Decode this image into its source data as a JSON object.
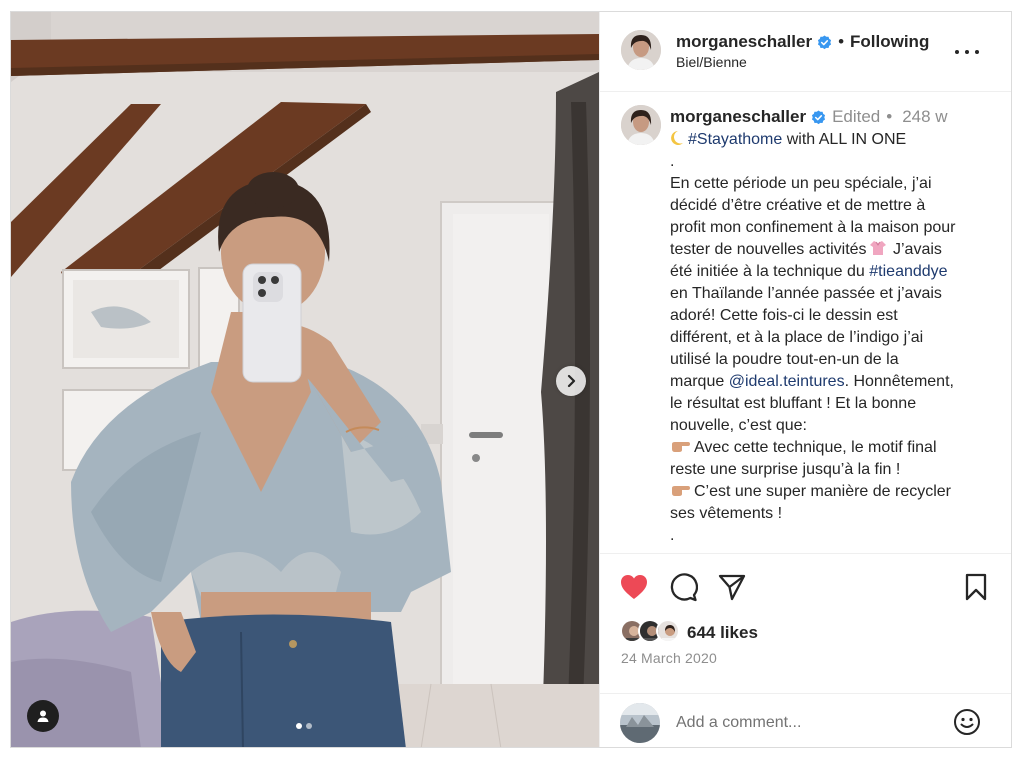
{
  "post": {
    "username": "morganeschaller",
    "follow_label": "Following",
    "location": "Biel/Bienne",
    "separator": "•"
  },
  "caption": {
    "username": "morganeschaller",
    "edited": "Edited",
    "edited_sep": "•",
    "time_ago": "248 w",
    "lines": {
      "l1_hashtag": "#Stayathome",
      "l1_rest": " with ALL IN ONE",
      "l2": ".",
      "l3": "En cette période un peu spéciale, j’ai",
      "l4": "décidé d’être créative et de mettre à",
      "l5": "profit mon confinement à la maison pour",
      "l6_a": "tester de nouvelles activités",
      "l6_b": " J’avais",
      "l7_a": "été initiée à la technique du ",
      "l7_hashtag": "#tieanddye",
      "l8": "en Thaïlande l’année passée et j’avais",
      "l9": "adoré! Cette fois-ci le dessin est",
      "l10": "différent, et à la place de l’indigo j’ai",
      "l11": "utilisé la poudre tout-en-un de la",
      "l12_a": "marque ",
      "l12_mention": "@ideal.teintures",
      "l12_b": ". Honnêtement,",
      "l13": "le résultat est bluffant ! Et la bonne",
      "l14": "nouvelle, c’est que:",
      "l15": "Avec cette technique, le motif final",
      "l16": "reste une surprise jusqu’à la fin !",
      "l17": "C’est une super manière de recycler",
      "l18": "ses vêtements !",
      "l19": "."
    }
  },
  "engagement": {
    "likes": "644 likes",
    "date": "24 March 2020"
  },
  "comment": {
    "placeholder": "Add a comment..."
  },
  "carousel": {
    "slides": 2,
    "current": 1
  },
  "colors": {
    "heart": "#ed4956",
    "link": "#1e3a6e",
    "verified": "#3897f0",
    "muted": "#8e8e8e"
  },
  "icons": {
    "like": "heart-filled-icon",
    "comment": "comment-bubble-icon",
    "share": "paper-plane-icon",
    "save": "bookmark-icon",
    "next": "chevron-right-icon",
    "tags": "user-tag-icon",
    "emoji": "smiley-icon",
    "more": "more-options-icon"
  }
}
